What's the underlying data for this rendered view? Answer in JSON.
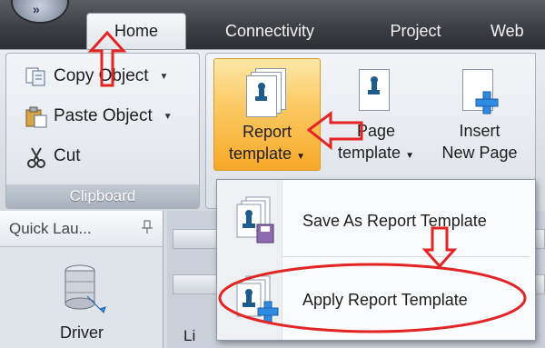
{
  "tabs": [
    "Home",
    "Connectivity",
    "Project",
    "Web"
  ],
  "clipboard": {
    "copy_label": "Copy Object",
    "paste_label": "Paste Object",
    "cut_label": "Cut",
    "group_label": "Clipboard"
  },
  "pages_group": {
    "report_template": [
      "Report",
      "template"
    ],
    "page_template": [
      "Page",
      "template"
    ],
    "insert_new_page": [
      "Insert",
      "New Page"
    ]
  },
  "quick_launch": {
    "title": "Quick Lau...",
    "pin": "⼂",
    "driver_label": "Driver"
  },
  "menu": {
    "save_as": "Save As Report Template",
    "apply": "Apply Report Template"
  },
  "work_area_label": "Li",
  "colors": {
    "annotation_red": "#e32424",
    "ribbon_hover": "#fbc861"
  }
}
